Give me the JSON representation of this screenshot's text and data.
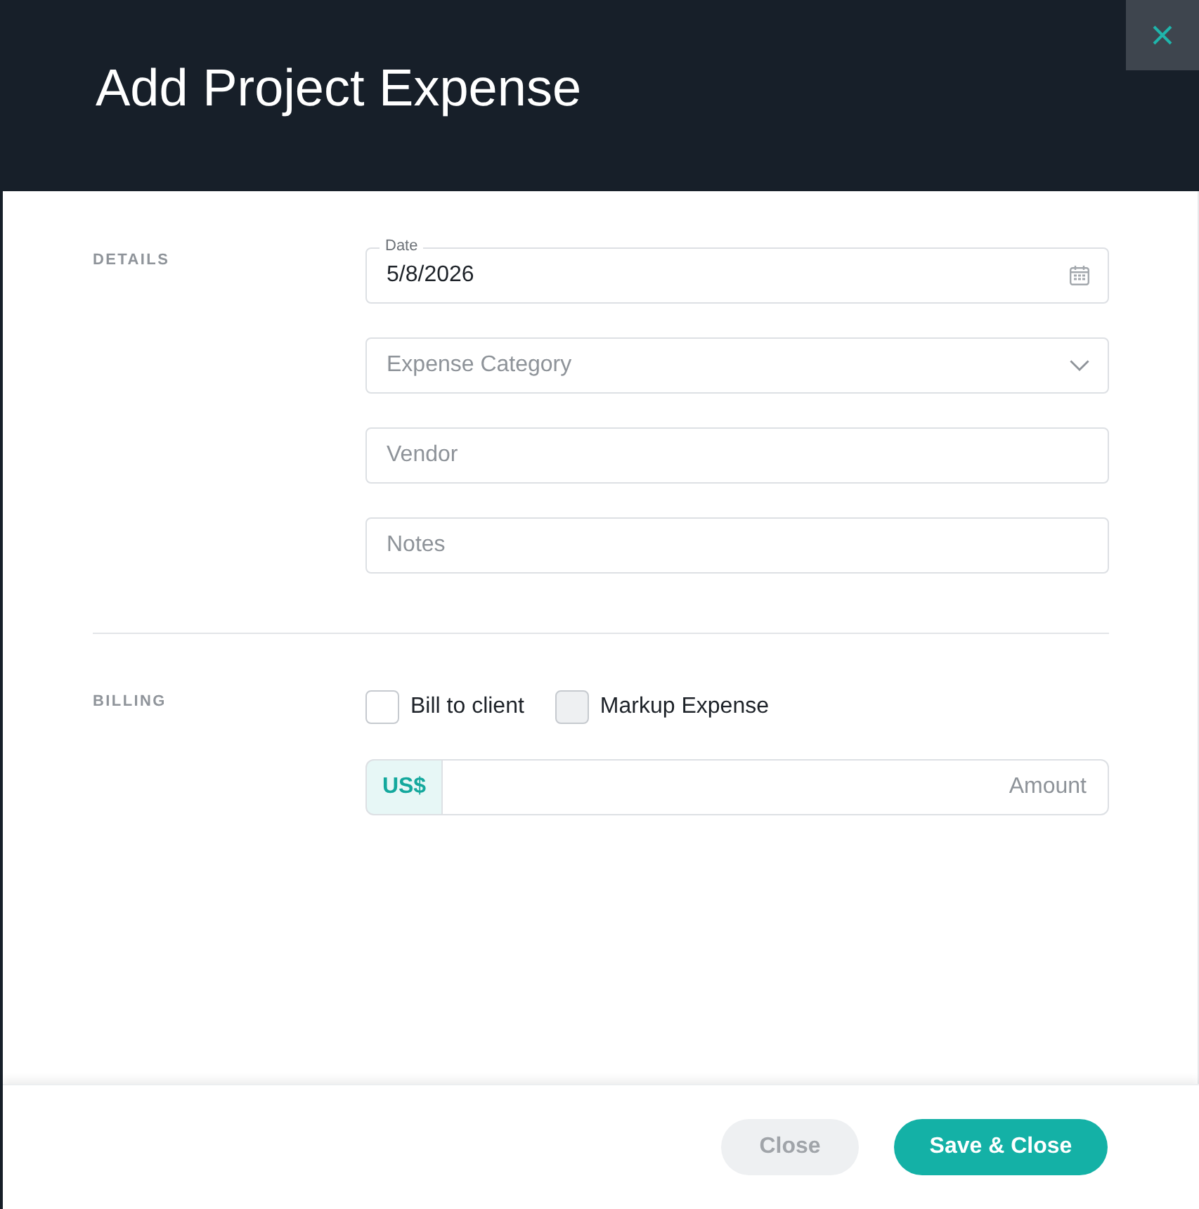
{
  "dialog": {
    "title": "Add Project Expense"
  },
  "sections": [
    {
      "heading": "DETAILS",
      "fields": [
        {
          "kind": "date",
          "label": "Date",
          "value": "5/8/2026"
        },
        {
          "kind": "select",
          "placeholder": "Expense Category"
        },
        {
          "kind": "text",
          "placeholder": "Vendor"
        },
        {
          "kind": "text",
          "placeholder": "Notes"
        }
      ]
    },
    {
      "heading": "BILLING",
      "checkboxes": [
        {
          "label": "Bill to client",
          "checked": false,
          "disabled": false
        },
        {
          "label": "Markup Expense",
          "checked": false,
          "disabled": true
        }
      ],
      "amount": {
        "prefix": "US$",
        "placeholder": "Amount"
      }
    }
  ],
  "footer": {
    "buttons": [
      {
        "label": "Close",
        "kind": "secondary"
      },
      {
        "label": "Save & Close",
        "kind": "primary"
      }
    ]
  }
}
